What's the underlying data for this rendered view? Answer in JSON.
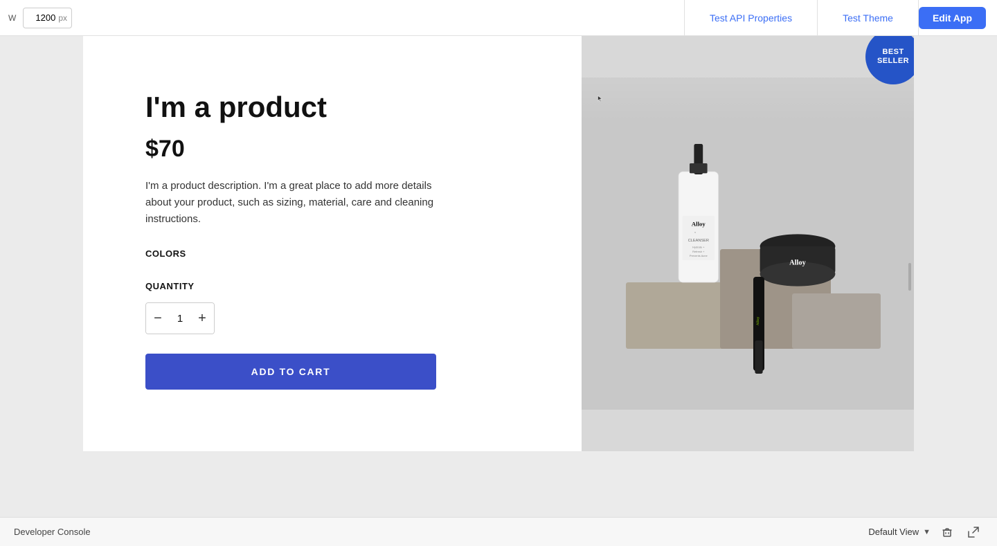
{
  "toolbar": {
    "width_label": "W",
    "width_value": "1200",
    "width_unit": "px",
    "tab_api": "Test API Properties",
    "tab_theme": "Test Theme",
    "edit_app_label": "Edit App"
  },
  "product": {
    "name": "I'm a product",
    "price": "$70",
    "description": "I'm a product description. I'm a great place to add more details about your product, such as sizing, material, care and cleaning instructions.",
    "colors_label": "COLORS",
    "quantity_label": "QUANTITY",
    "qty_minus": "−",
    "qty_value": "1",
    "qty_plus": "+",
    "add_to_cart": "ADD TO CART",
    "badge_line1": "BEST",
    "badge_line2": "SELLER"
  },
  "bottom_bar": {
    "developer_console": "Developer Console",
    "default_view": "Default View"
  }
}
